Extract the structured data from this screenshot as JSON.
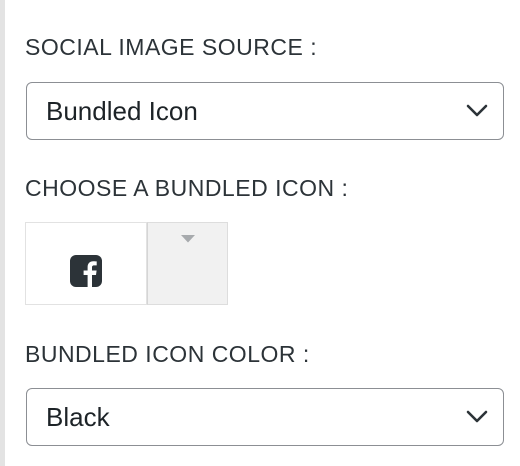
{
  "social_image_source": {
    "label": "SOCIAL IMAGE SOURCE :",
    "selected": "Bundled Icon"
  },
  "bundled_icon": {
    "label": "CHOOSE A BUNDLED ICON :",
    "selected_icon": "facebook-square-icon"
  },
  "bundled_icon_color": {
    "label": "BUNDLED ICON COLOR :",
    "selected": "Black"
  },
  "colors": {
    "icon": "#2c3338",
    "border": "#8c8f94",
    "picker_toggle_bg": "#f1f1f1"
  }
}
